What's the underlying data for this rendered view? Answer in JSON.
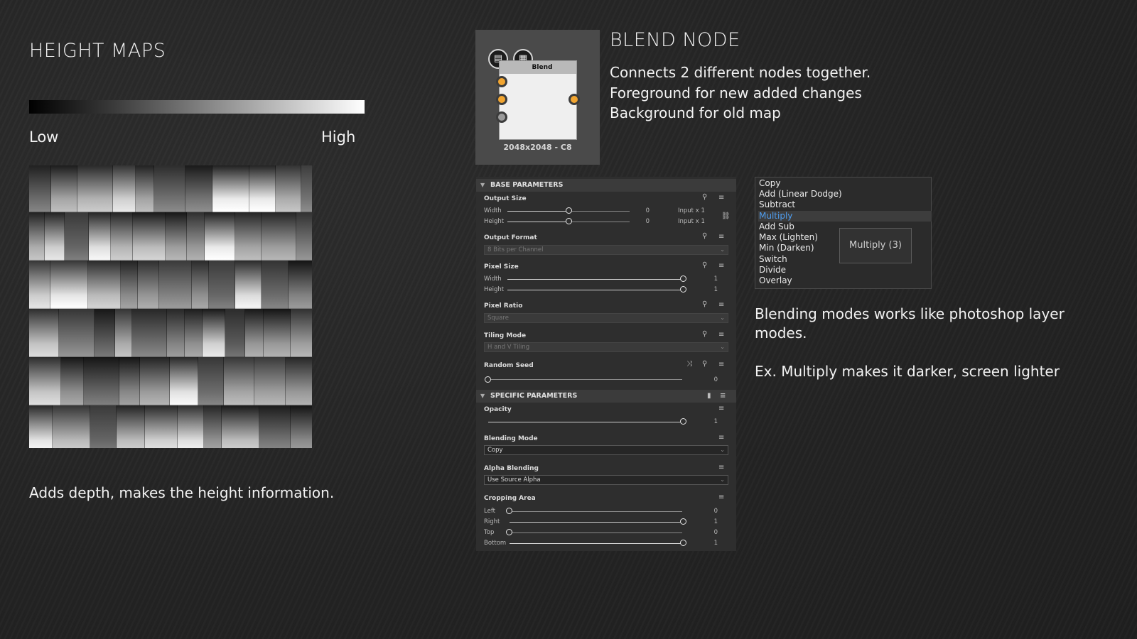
{
  "height_maps": {
    "title": "HEIGHT MAPS",
    "gradient_low": "Low",
    "gradient_high": "High",
    "caption": "Adds depth, makes the height information."
  },
  "node": {
    "header": "Blend",
    "resolution": "2048x2048 - C8",
    "badge_1_icon": "document-icon",
    "badge_2_icon": "checker-icon"
  },
  "blend_node": {
    "title": "BLEND NODE",
    "lines": [
      "Connects 2 different nodes together.",
      "Foreground for new added changes",
      "Background for old map"
    ]
  },
  "panel": {
    "base_section": "BASE PARAMETERS",
    "output_size": {
      "label": "Output Size",
      "width_label": "Width",
      "height_label": "Height",
      "width_value": "0",
      "height_value": "0",
      "width_input": "Input x 1",
      "height_input": "Input x 1"
    },
    "output_format": {
      "label": "Output Format",
      "value": "8 Bits per Channel"
    },
    "pixel_size": {
      "label": "Pixel Size",
      "width_label": "Width",
      "height_label": "Height",
      "width_value": "1",
      "height_value": "1"
    },
    "pixel_ratio": {
      "label": "Pixel Ratio",
      "value": "Square"
    },
    "tiling_mode": {
      "label": "Tiling Mode",
      "value": "H and V Tiling"
    },
    "random_seed": {
      "label": "Random Seed",
      "value": "0"
    },
    "specific_section": "SPECIFIC PARAMETERS",
    "opacity": {
      "label": "Opacity",
      "value": "1"
    },
    "blending_mode": {
      "label": "Blending Mode",
      "value": "Copy"
    },
    "alpha_blending": {
      "label": "Alpha Blending",
      "value": "Use Source Alpha"
    },
    "cropping_area": {
      "label": "Cropping Area",
      "left_label": "Left",
      "left_value": "0",
      "right_label": "Right",
      "right_value": "1",
      "top_label": "Top",
      "top_value": "0",
      "bottom_label": "Bottom",
      "bottom_value": "1"
    }
  },
  "blend_menu": {
    "items": [
      "Copy",
      "Add (Linear Dodge)",
      "Subtract",
      "Multiply",
      "Add Sub",
      "Max (Lighten)",
      "Min (Darken)",
      "Switch",
      "Divide",
      "Overlay"
    ],
    "selected": "Multiply",
    "tooltip": "Multiply (3)"
  },
  "notes": {
    "line1": "Blending modes works like photoshop layer",
    "line2": "modes.",
    "line3": "Ex. Multiply makes it darker, screen lighter"
  },
  "colors": {
    "pin_orange": "#f2a530",
    "menu_selected": "#4f9ef0",
    "background": "#262626"
  }
}
